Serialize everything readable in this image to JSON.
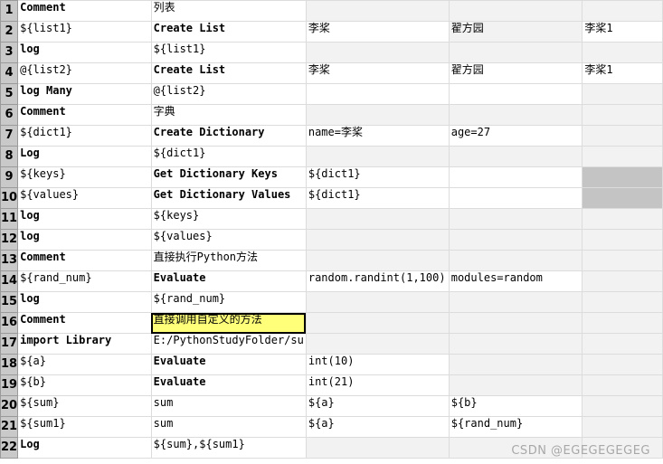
{
  "rows": [
    {
      "num": "1",
      "cells": [
        {
          "text": "Comment",
          "cls": "kw"
        },
        {
          "text": "列表",
          "cls": "cmt"
        },
        {
          "text": "",
          "cls": ""
        },
        {
          "text": "",
          "cls": ""
        },
        {
          "text": "",
          "cls": ""
        }
      ]
    },
    {
      "num": "2",
      "cells": [
        {
          "text": "${list1}",
          "cls": "var"
        },
        {
          "text": "Create List",
          "cls": "kw"
        },
        {
          "text": "李桨",
          "cls": "normal"
        },
        {
          "text": "翟方园",
          "cls": "normal"
        },
        {
          "text": "李桨1",
          "cls": "normal"
        }
      ]
    },
    {
      "num": "3",
      "cells": [
        {
          "text": "log",
          "cls": "kw"
        },
        {
          "text": "${list1}",
          "cls": "var"
        },
        {
          "text": "",
          "cls": ""
        },
        {
          "text": "",
          "cls": ""
        },
        {
          "text": "",
          "cls": ""
        }
      ]
    },
    {
      "num": "4",
      "cells": [
        {
          "text": "@{list2}",
          "cls": "var"
        },
        {
          "text": "Create List",
          "cls": "kw"
        },
        {
          "text": "李桨",
          "cls": "normal"
        },
        {
          "text": "翟方园",
          "cls": "normal"
        },
        {
          "text": "李桨1",
          "cls": "normal"
        }
      ]
    },
    {
      "num": "5",
      "cells": [
        {
          "text": "log Many",
          "cls": "kw"
        },
        {
          "text": "@{list2}",
          "cls": "var"
        },
        {
          "text": "",
          "cls": ""
        },
        {
          "text": "",
          "cls": ""
        },
        {
          "text": "",
          "cls": ""
        }
      ]
    },
    {
      "num": "6",
      "cells": [
        {
          "text": "Comment",
          "cls": "kw"
        },
        {
          "text": "字典",
          "cls": "cmt"
        },
        {
          "text": "",
          "cls": ""
        },
        {
          "text": "",
          "cls": ""
        },
        {
          "text": "",
          "cls": ""
        }
      ]
    },
    {
      "num": "7",
      "cells": [
        {
          "text": "${dict1}",
          "cls": "var"
        },
        {
          "text": "Create Dictionary",
          "cls": "kw"
        },
        {
          "text": "name=李桨",
          "cls": "normal"
        },
        {
          "text": "age=27",
          "cls": "normal"
        },
        {
          "text": "",
          "cls": ""
        }
      ]
    },
    {
      "num": "8",
      "cells": [
        {
          "text": "Log",
          "cls": "kw"
        },
        {
          "text": "${dict1}",
          "cls": "var"
        },
        {
          "text": "",
          "cls": ""
        },
        {
          "text": "",
          "cls": ""
        },
        {
          "text": "",
          "cls": ""
        }
      ]
    },
    {
      "num": "9",
      "cells": [
        {
          "text": "${keys}",
          "cls": "var"
        },
        {
          "text": "Get Dictionary Keys",
          "cls": "kw"
        },
        {
          "text": "${dict1}",
          "cls": "var"
        },
        {
          "text": "",
          "cls": ""
        },
        {
          "text": "",
          "cls": ""
        }
      ]
    },
    {
      "num": "10",
      "cells": [
        {
          "text": "${values}",
          "cls": "var"
        },
        {
          "text": "Get Dictionary Values",
          "cls": "kw"
        },
        {
          "text": "${dict1}",
          "cls": "var"
        },
        {
          "text": "",
          "cls": ""
        },
        {
          "text": "",
          "cls": ""
        }
      ]
    },
    {
      "num": "11",
      "cells": [
        {
          "text": "log",
          "cls": "kw"
        },
        {
          "text": "${keys}",
          "cls": "var"
        },
        {
          "text": "",
          "cls": ""
        },
        {
          "text": "",
          "cls": ""
        },
        {
          "text": "",
          "cls": ""
        }
      ]
    },
    {
      "num": "12",
      "cells": [
        {
          "text": "log",
          "cls": "kw"
        },
        {
          "text": "${values}",
          "cls": "var"
        },
        {
          "text": "",
          "cls": ""
        },
        {
          "text": "",
          "cls": ""
        },
        {
          "text": "",
          "cls": ""
        }
      ]
    },
    {
      "num": "13",
      "cells": [
        {
          "text": "Comment",
          "cls": "kw"
        },
        {
          "text": "直接执行Python方法",
          "cls": "cmt"
        },
        {
          "text": "",
          "cls": ""
        },
        {
          "text": "",
          "cls": ""
        },
        {
          "text": "",
          "cls": ""
        }
      ]
    },
    {
      "num": "14",
      "cells": [
        {
          "text": "${rand_num}",
          "cls": "var"
        },
        {
          "text": "Evaluate",
          "cls": "kw"
        },
        {
          "text": "random.randint(1,100)",
          "cls": "normal"
        },
        {
          "text": "modules=random",
          "cls": "normal"
        },
        {
          "text": "",
          "cls": ""
        }
      ]
    },
    {
      "num": "15",
      "cells": [
        {
          "text": "log",
          "cls": "kw"
        },
        {
          "text": "${rand_num}",
          "cls": "var"
        },
        {
          "text": "",
          "cls": ""
        },
        {
          "text": "",
          "cls": ""
        },
        {
          "text": "",
          "cls": ""
        }
      ]
    },
    {
      "num": "16",
      "cells": [
        {
          "text": "Comment",
          "cls": "kw"
        },
        {
          "text": "直接调用自定义的方法",
          "cls": "cmt"
        },
        {
          "text": "",
          "cls": ""
        },
        {
          "text": "",
          "cls": ""
        },
        {
          "text": "",
          "cls": ""
        }
      ]
    },
    {
      "num": "17",
      "cells": [
        {
          "text": "import Library",
          "cls": "kw"
        },
        {
          "text": "E:/PythonStudyFolder/su",
          "cls": "normal"
        },
        {
          "text": "",
          "cls": ""
        },
        {
          "text": "",
          "cls": ""
        },
        {
          "text": "",
          "cls": ""
        }
      ]
    },
    {
      "num": "18",
      "cells": [
        {
          "text": "${a}",
          "cls": "var"
        },
        {
          "text": "Evaluate",
          "cls": "kw"
        },
        {
          "text": "int(10)",
          "cls": "normal"
        },
        {
          "text": "",
          "cls": ""
        },
        {
          "text": "",
          "cls": ""
        }
      ]
    },
    {
      "num": "19",
      "cells": [
        {
          "text": "${b}",
          "cls": "var"
        },
        {
          "text": "Evaluate",
          "cls": "kw"
        },
        {
          "text": "int(21)",
          "cls": "normal"
        },
        {
          "text": "",
          "cls": ""
        },
        {
          "text": "",
          "cls": ""
        }
      ]
    },
    {
      "num": "20",
      "cells": [
        {
          "text": "${sum}",
          "cls": "var"
        },
        {
          "text": "sum",
          "cls": "normal"
        },
        {
          "text": "${a}",
          "cls": "var"
        },
        {
          "text": "${b}",
          "cls": "var"
        },
        {
          "text": "",
          "cls": ""
        }
      ]
    },
    {
      "num": "21",
      "cells": [
        {
          "text": "${sum1}",
          "cls": "var"
        },
        {
          "text": "sum",
          "cls": "normal"
        },
        {
          "text": "${a}",
          "cls": "var"
        },
        {
          "text": "${rand_num}",
          "cls": "var"
        },
        {
          "text": "",
          "cls": ""
        }
      ]
    },
    {
      "num": "22",
      "cells": [
        {
          "text": "Log",
          "cls": "kw"
        },
        {
          "text": "${sum},${sum1}",
          "cls": "normal"
        },
        {
          "text": "",
          "cls": ""
        },
        {
          "text": "",
          "cls": ""
        },
        {
          "text": "",
          "cls": ""
        }
      ]
    }
  ],
  "watermark": "CSDN @EGEGEGEGEG",
  "colors": {
    "keyword": "#1a6fa0",
    "variable": "#2d7a2d",
    "comment": "#8b1a1a",
    "highlight": "#ffff7a",
    "rownum_bg": "#c9c9c9"
  }
}
